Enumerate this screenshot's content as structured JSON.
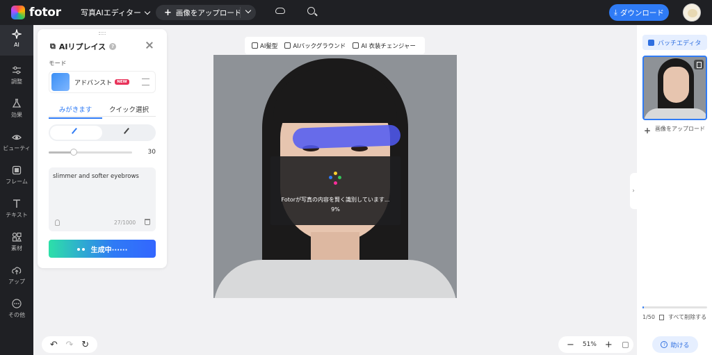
{
  "header": {
    "logo_text": "fotor",
    "editor_menu": "写真AIエディター",
    "upload_label": "画像をアップロード",
    "download_label": "ダウンロード"
  },
  "sidebar": {
    "items": [
      {
        "label": "AI",
        "icon": "sparkle-icon",
        "active": true
      },
      {
        "label": "調整",
        "icon": "sliders-icon"
      },
      {
        "label": "効果",
        "icon": "flask-icon"
      },
      {
        "label": "ビューティ",
        "icon": "eye-icon"
      },
      {
        "label": "フレーム",
        "icon": "frame-icon"
      },
      {
        "label": "テキスト",
        "icon": "text-icon"
      },
      {
        "label": "素材",
        "icon": "shapes-icon"
      },
      {
        "label": "アップ",
        "icon": "cloud-upload-icon"
      },
      {
        "label": "その他",
        "icon": "more-icon"
      }
    ]
  },
  "panel": {
    "title": "AIリプレイス",
    "mode_label": "モード",
    "mode_name": "アドバンスト",
    "new_badge": "NEW",
    "tabs": [
      "みがきます",
      "クイック選択"
    ],
    "active_tab": 0,
    "brush_size": 30,
    "brush_max": 100,
    "prompt_text": "slimmer and softer eyebrows",
    "prompt_count": "27/1000",
    "generate_label": "生成中······"
  },
  "ai_toolbar": {
    "tools": [
      "AI髪型",
      "AIバックグラウンド",
      "AI 衣装チェンジャー"
    ]
  },
  "canvas": {
    "loading_text": "Fotorが写真の内容を賢く識別しています...",
    "loading_percent": "9%"
  },
  "zoom": {
    "level": "51%"
  },
  "right_panel": {
    "batch_label": "バッチエディタ",
    "add_image_label": "画像をアップロード",
    "count": "1/50",
    "delete_all_label": "すべて削除する",
    "progress": 0.02,
    "help_label": "助ける"
  },
  "colors": {
    "accent": "#2f7bf5",
    "topbar": "#1f2024",
    "mask": "#505af5"
  }
}
